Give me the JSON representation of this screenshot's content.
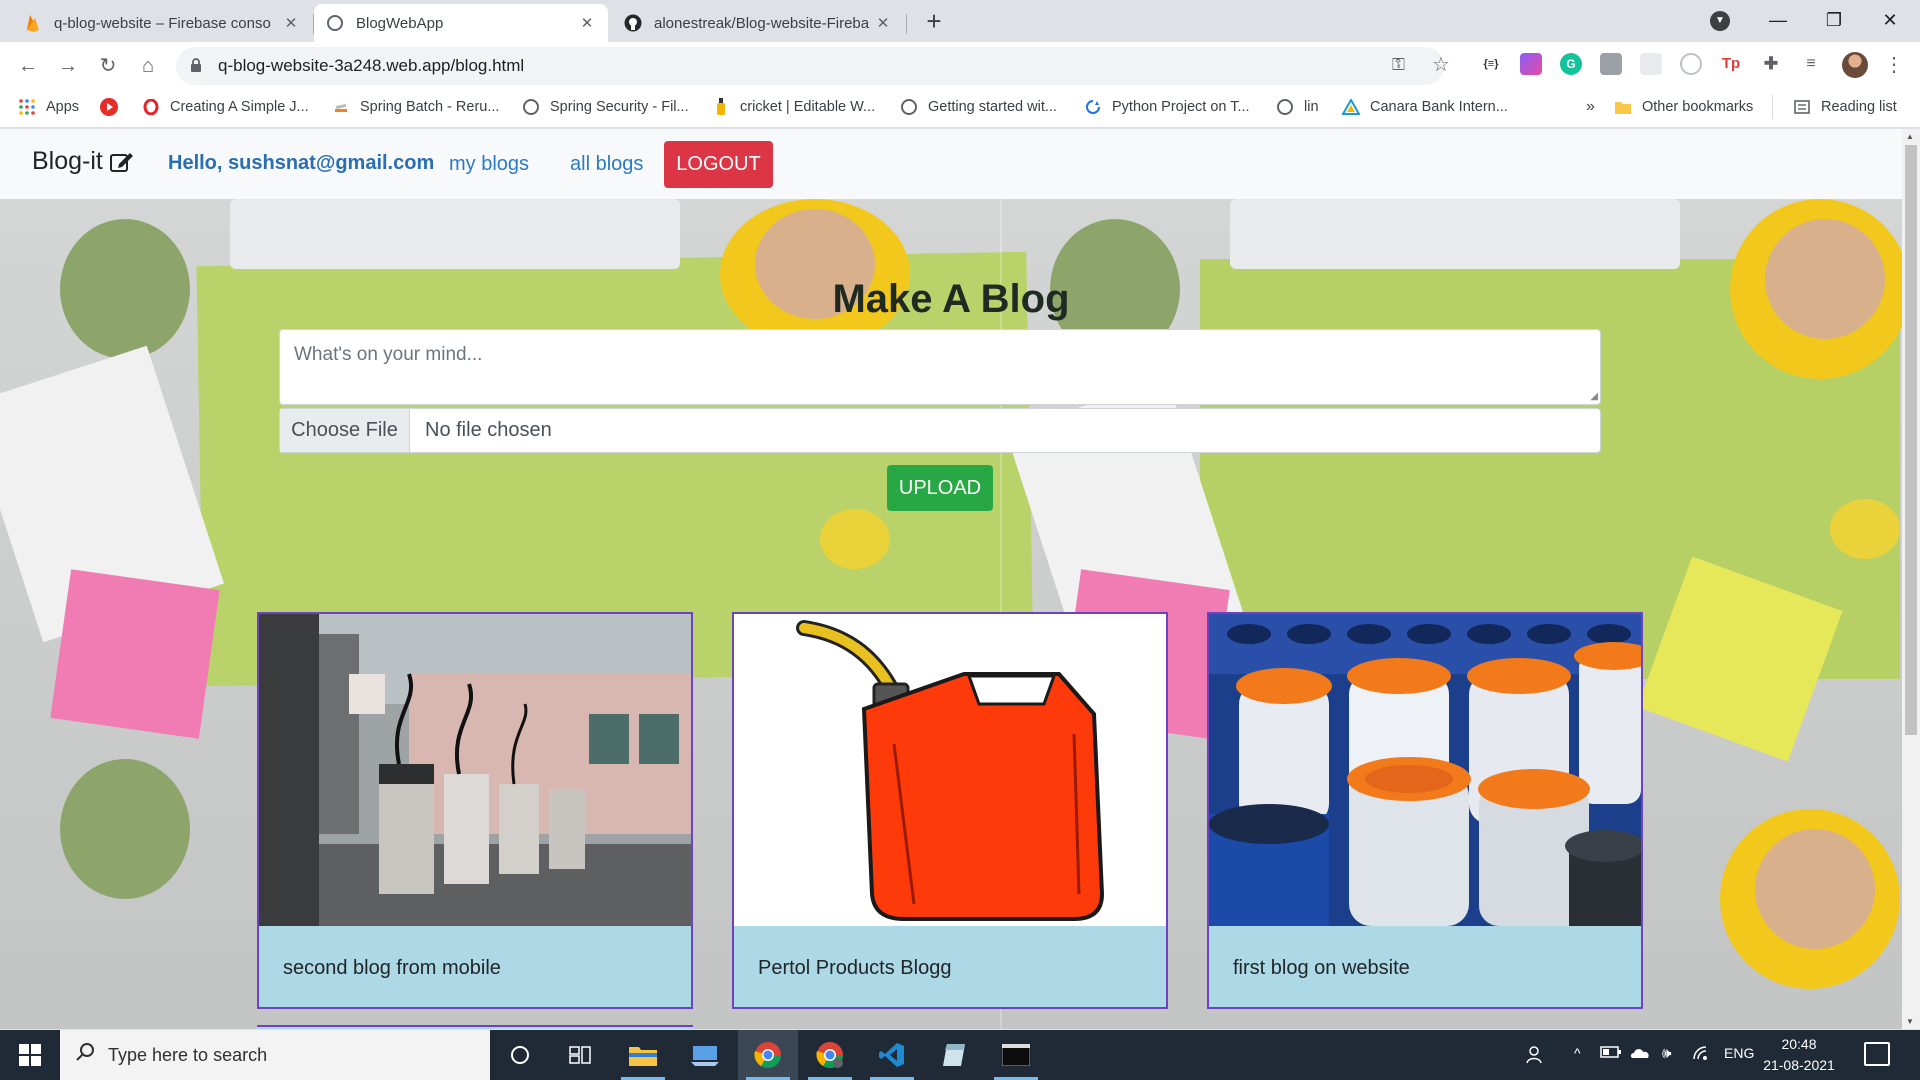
{
  "browser": {
    "tabs": [
      {
        "title": "q-blog-website – Firebase conso",
        "favicon": "firebase-icon"
      },
      {
        "title": "BlogWebApp",
        "favicon": "globe-icon"
      },
      {
        "title": "alonestreak/Blog-website-Fireba",
        "favicon": "github-icon"
      }
    ],
    "tab_close": "✕",
    "new_tab": "+",
    "window_controls": {
      "minimize": "—",
      "maximize": "❐",
      "close": "✕"
    },
    "profile_dropdown": "▼",
    "url": "q-blog-website-3a248.web.app/blog.html",
    "nav": {
      "back": "←",
      "forward": "→",
      "reload": "↻",
      "home": "⌂"
    },
    "omnibox_icons": {
      "key": "⚿",
      "star": "☆"
    }
  },
  "bookmarks": {
    "items": [
      {
        "label": "Apps",
        "icon": "apps-grid-icon"
      },
      {
        "label": "",
        "icon": "red-play-icon"
      },
      {
        "label": "Creating A Simple J...",
        "icon": "opera-icon"
      },
      {
        "label": "Spring Batch - Reru...",
        "icon": "stack-icon"
      },
      {
        "label": "Spring Security - Fil...",
        "icon": "globe-icon"
      },
      {
        "label": "cricket | Editable W...",
        "icon": "bottle-icon"
      },
      {
        "label": "Getting started wit...",
        "icon": "globe-icon"
      },
      {
        "label": "Python Project on T...",
        "icon": "sync-icon"
      },
      {
        "label": "lin",
        "icon": "globe-icon"
      },
      {
        "label": "Canara Bank Intern...",
        "icon": "triangle-icon"
      }
    ],
    "overflow": "»",
    "other": "Other bookmarks",
    "reading_list": "Reading list"
  },
  "site": {
    "brand": "Blog-it",
    "greeting": "Hello, sushsnat@gmail.com",
    "links": {
      "my_blogs": "my blogs",
      "all_blogs": "all blogs"
    },
    "logout": "LOGOUT",
    "heading": "Make A Blog",
    "textarea_placeholder": "What's on your mind...",
    "file": {
      "button": "Choose File",
      "status": "No file chosen"
    },
    "upload": "UPLOAD",
    "cards": [
      {
        "caption": "second blog from mobile",
        "image": "petrol-station-photo"
      },
      {
        "caption": "Pertol Products Blogg",
        "image": "red-jerrycan-illustration"
      },
      {
        "caption": "first blog on website",
        "image": "barrels-photo"
      }
    ]
  },
  "taskbar": {
    "search_placeholder": "Type here to search",
    "language": "ENG",
    "time": "20:48",
    "date": "21-08-2021"
  },
  "colors": {
    "logout": "#dc3545",
    "upload": "#28a745",
    "card_border": "#6f42c1",
    "card_bg": "#add8e6",
    "link": "#2a7ac6"
  }
}
